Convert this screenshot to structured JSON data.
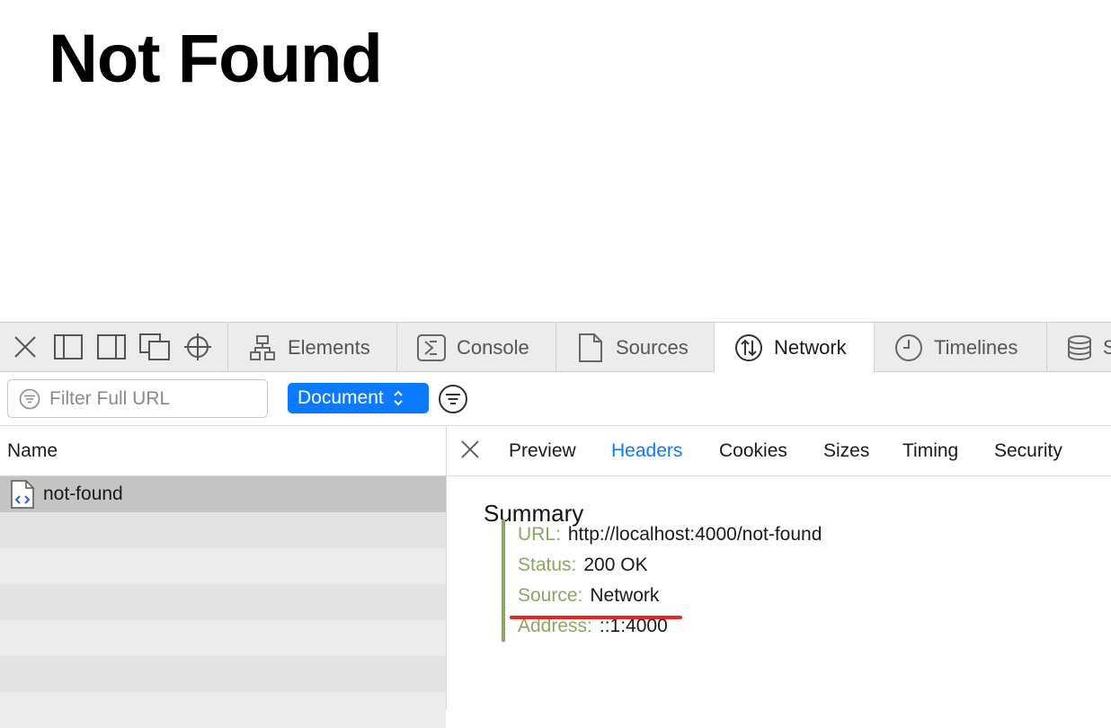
{
  "page": {
    "heading": "Not Found"
  },
  "toolbar": {
    "tabs": [
      {
        "label": "Elements",
        "icon": "elements-icon"
      },
      {
        "label": "Console",
        "icon": "console-icon"
      },
      {
        "label": "Sources",
        "icon": "sources-icon"
      },
      {
        "label": "Network",
        "icon": "network-icon",
        "active": true
      },
      {
        "label": "Timelines",
        "icon": "timelines-icon"
      },
      {
        "label": "S",
        "icon": "storage-icon"
      }
    ]
  },
  "filter": {
    "placeholder": "Filter Full URL",
    "type_select": "Document"
  },
  "list": {
    "header": "Name",
    "rows": [
      {
        "label": "not-found",
        "selected": true
      }
    ]
  },
  "detail": {
    "tabs": [
      "Preview",
      "Headers",
      "Cookies",
      "Sizes",
      "Timing",
      "Security"
    ],
    "active_tab": "Headers",
    "summary_title": "Summary",
    "summary": [
      {
        "key": "URL:",
        "value": "http://localhost:4000/not-found"
      },
      {
        "key": "Status:",
        "value": "200 OK"
      },
      {
        "key": "Source:",
        "value": "Network"
      },
      {
        "key": "Address:",
        "value": "::1:4000"
      }
    ]
  },
  "colors": {
    "accent": "#0a7aff",
    "summary_key": "#8ca665",
    "annotation": "#e8261a"
  }
}
